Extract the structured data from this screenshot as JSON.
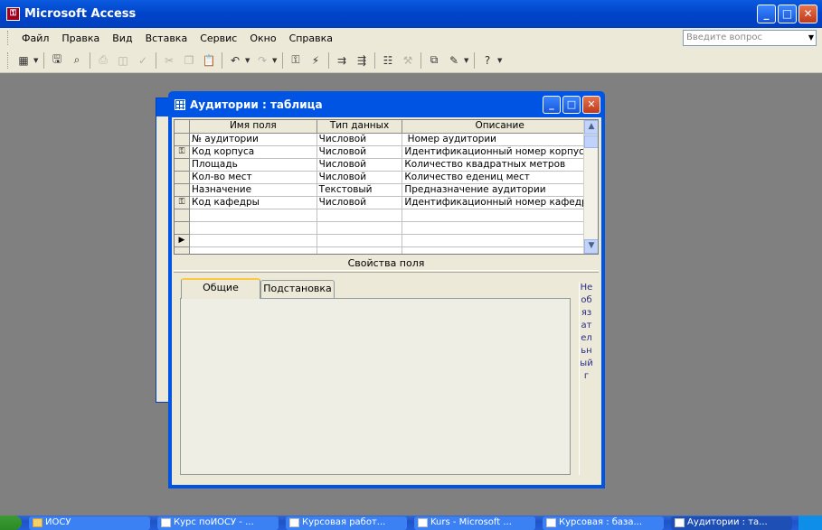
{
  "app": {
    "title": "Microsoft Access",
    "icon": "access-key-icon"
  },
  "menu": {
    "items": [
      "Файл",
      "Правка",
      "Вид",
      "Вставка",
      "Сервис",
      "Окно",
      "Справка"
    ],
    "ask_placeholder": "Введите вопрос"
  },
  "toolbar": {
    "buttons": [
      "view-icon",
      "save-icon",
      "search-icon",
      "print-icon",
      "print-preview-icon",
      "spelling-icon",
      "cut-icon",
      "copy-icon",
      "paste-icon",
      "undo-icon",
      "redo-icon",
      "primary-key-icon",
      "indexes-icon",
      "insert-rows-icon",
      "delete-rows-icon",
      "properties-icon",
      "build-icon",
      "database-window-icon",
      "new-object-icon",
      "help-icon"
    ]
  },
  "table_window": {
    "title": "Аудитории : таблица",
    "columns": [
      "Имя поля",
      "Тип данных",
      "Описание"
    ],
    "rows": [
      {
        "key": false,
        "name": "№ аудитории",
        "type": "Числовой",
        "desc": " Номер аудитории"
      },
      {
        "key": true,
        "name": "Код корпуса",
        "type": "Числовой",
        "desc": "Идентификационный номер корпуса"
      },
      {
        "key": false,
        "name": "Площадь",
        "type": "Числовой",
        "desc": "Количество квадратных метров"
      },
      {
        "key": false,
        "name": "Кол-во мест",
        "type": "Числовой",
        "desc": "Количество едениц мест"
      },
      {
        "key": false,
        "name": "Назначение",
        "type": "Текстовый",
        "desc": "Предназначение аудитории"
      },
      {
        "key": true,
        "name": "Код кафедры",
        "type": "Числовой",
        "desc": "Идентификационный номер кафедры"
      }
    ],
    "field_properties_label": "Свойства поля",
    "tabs": [
      "Общие",
      "Подстановка"
    ],
    "hint_text": "Необязательный г"
  },
  "taskbar": {
    "buttons": [
      {
        "label": "ИОСУ",
        "icon": "folder-icon"
      },
      {
        "label": "Курс поИОСУ - ...",
        "icon": "word-doc-icon"
      },
      {
        "label": "Курсовая работ...",
        "icon": "word-doc-icon"
      },
      {
        "label": "Kurs - Microsoft ...",
        "icon": "word-doc-icon"
      },
      {
        "label": "Курсовая : база...",
        "icon": "access-db-icon"
      },
      {
        "label": "Аудитории : та...",
        "icon": "table-icon"
      }
    ]
  }
}
